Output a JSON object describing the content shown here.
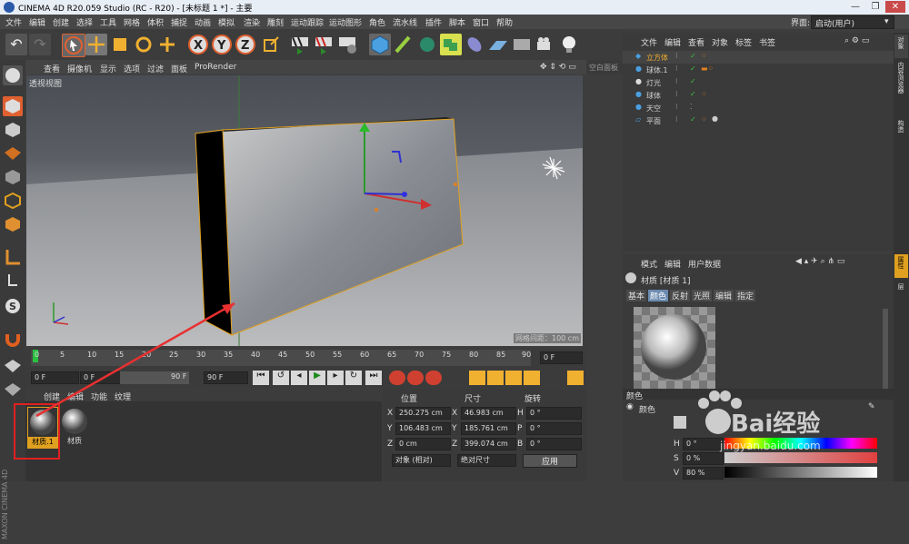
{
  "title": "CINEMA 4D R20.059 Studio (RC - R20) - [未标题 1 *] - 主要",
  "window_controls": [
    "—",
    "❐",
    "✕"
  ],
  "menu": [
    "文件",
    "编辑",
    "创建",
    "选择",
    "工具",
    "网格",
    "体积",
    "捕捉",
    "动画",
    "模拟",
    "渲染",
    "雕刻",
    "运动跟踪",
    "运动图形",
    "角色",
    "流水线",
    "插件",
    "脚本",
    "窗口",
    "帮助"
  ],
  "layout_label": "界面:",
  "layout_value": "启动(用户)",
  "viewport": {
    "menu": [
      "查看",
      "摄像机",
      "显示",
      "选项",
      "过滤",
      "面板",
      "ProRender"
    ],
    "label": "透视视图",
    "grid_spacing": "网格间距：100 cm"
  },
  "side_tab": "空白面板",
  "timeline": {
    "ticks": [
      "0",
      "5",
      "10",
      "15",
      "20",
      "25",
      "30",
      "35",
      "40",
      "45",
      "50",
      "55",
      "60",
      "65",
      "70",
      "75",
      "80",
      "85",
      "90"
    ],
    "frame_end": "0 F"
  },
  "playbar": {
    "current": "0 F",
    "start": "0 F",
    "end_small": "90 F",
    "end": "90 F"
  },
  "material_panel": {
    "menu": [
      "创建",
      "编辑",
      "功能",
      "纹理"
    ],
    "materials": [
      {
        "name": "材质.1"
      },
      {
        "name": "材质"
      }
    ]
  },
  "coords": {
    "headers": [
      "位置",
      "尺寸",
      "旋转"
    ],
    "rows": [
      {
        "axis": "X",
        "pos": "250.275 cm",
        "size_axis": "X",
        "size": "46.983 cm",
        "rot_axis": "H",
        "rot": "0 °"
      },
      {
        "axis": "Y",
        "pos": "106.483 cm",
        "size_axis": "Y",
        "size": "185.761 cm",
        "rot_axis": "P",
        "rot": "0 °"
      },
      {
        "axis": "Z",
        "pos": "0 cm",
        "size_axis": "Z",
        "size": "399.074 cm",
        "rot_axis": "B",
        "rot": "0 °"
      }
    ],
    "mode1": "对象 (相对)",
    "mode2": "绝对尺寸",
    "apply": "应用"
  },
  "object_manager": {
    "menu": [
      "文件",
      "编辑",
      "查看",
      "对象",
      "标签",
      "书签"
    ],
    "objects": [
      {
        "name": "立方体",
        "color": "#f0b030"
      },
      {
        "name": "球体.1",
        "color": "#d0d0d0"
      },
      {
        "name": "灯光",
        "color": "#d0d0d0"
      },
      {
        "name": "球体",
        "color": "#d0d0d0"
      },
      {
        "name": "天空",
        "color": "#d0d0d0"
      },
      {
        "name": "平面",
        "color": "#d0d0d0"
      }
    ]
  },
  "right_tabs": [
    "对象",
    "内容浏览器",
    "构造",
    "属性",
    "层"
  ],
  "attributes": {
    "menu": [
      "模式",
      "编辑",
      "用户数据"
    ],
    "title": "材质 [材质 1]",
    "tabs": [
      "基本",
      "颜色",
      "反射",
      "光照",
      "编辑",
      "指定"
    ],
    "section": "颜色",
    "color_label": "颜色",
    "hsv": [
      {
        "k": "H",
        "v": "0 °"
      },
      {
        "k": "S",
        "v": "0 %"
      },
      {
        "k": "V",
        "v": "80 %"
      }
    ]
  },
  "watermark": {
    "brand": "Bai经验",
    "url": "jingyan.baidu.com"
  },
  "maxon": "MAXON CINEMA 4D"
}
